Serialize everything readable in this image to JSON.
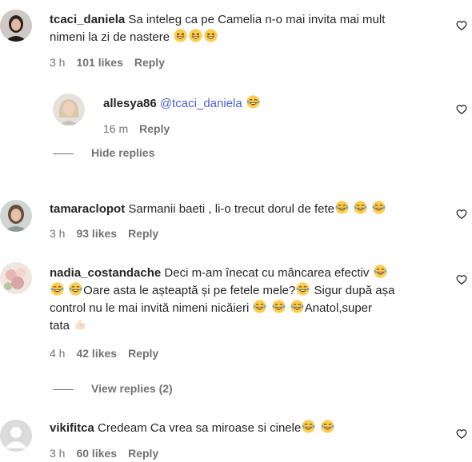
{
  "comments": [
    {
      "user": "tcaci_daniela",
      "text": "Sa inteleg ca pe Camelia n-o mai invita mai mult",
      "text2": "nimeni la zi de nastere",
      "time": "3 h",
      "likes": "101 likes",
      "reply": "Reply"
    },
    {
      "user": "allesya86",
      "mention": "@tcaci_daniela",
      "time": "16 m",
      "reply": "Reply"
    },
    {
      "user": "tamaraclopot",
      "text": "Sarmanii baeti , li-o trecut dorul de fete",
      "time": "3 h",
      "likes": "93 likes",
      "reply": "Reply"
    },
    {
      "user": "nadia_costandache",
      "line1": "Deci m-am înecat cu mâncarea efectiv",
      "line2": "Oare asta le așteaptă și pe fetele mele?",
      "line2b": "Sigur după așa",
      "line3": "control nu le mai invită nimeni nicăieri",
      "line3b": "Anatol,super",
      "line4": "tata",
      "time": "4 h",
      "likes": "42 likes",
      "reply": "Reply"
    },
    {
      "user": "vikifitca",
      "text": "Credeam Ca vrea sa miroase si cinele",
      "time": "3 h",
      "likes": "60 likes",
      "reply": "Reply"
    }
  ],
  "toggles": {
    "hide": "Hide replies",
    "view": "View replies (2)"
  },
  "icons": {
    "heart": "heart-outline-icon",
    "grin": "grinning-squinting-face-emoji",
    "laugh": "face-with-tears-of-joy-emoji",
    "muscle": "flexed-biceps-emoji",
    "default_avatar": "default-user-avatar"
  }
}
